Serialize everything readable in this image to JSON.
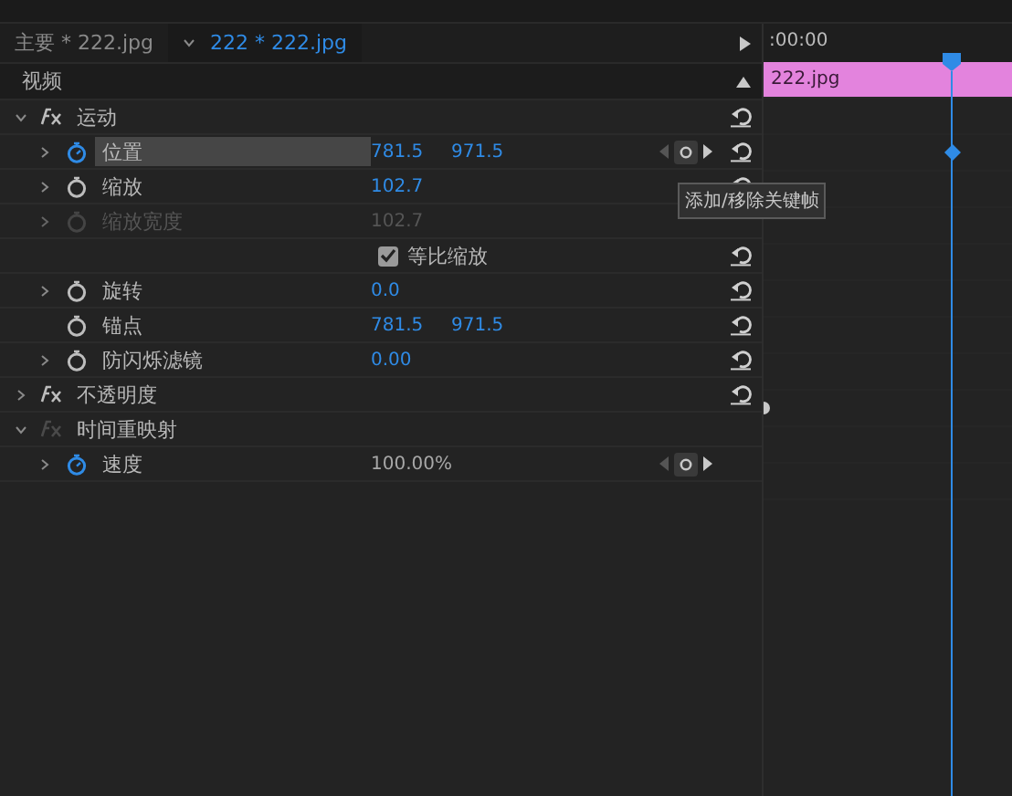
{
  "tabs": [
    {
      "label": "主要 * 222.jpg",
      "selected": false,
      "dropdown": false
    },
    {
      "label": "222 * 222.jpg",
      "selected": true,
      "dropdown": true
    }
  ],
  "section": {
    "label": "视频"
  },
  "timeline": {
    "time": ":00:00",
    "clip": "222.jpg"
  },
  "rows": [
    {
      "kind": "effect",
      "name": "运动",
      "expanded": true,
      "enabled": true,
      "reset": true
    },
    {
      "kind": "property",
      "name": "位置",
      "expandable": true,
      "animated": true,
      "disabled": false,
      "selected": true,
      "values": [
        "781.5",
        "971.5"
      ],
      "nav": true,
      "reset": true,
      "keyframe": true
    },
    {
      "kind": "property",
      "name": "缩放",
      "expandable": true,
      "animated": false,
      "disabled": false,
      "selected": false,
      "values": [
        "102.7"
      ],
      "nav": false,
      "reset": true
    },
    {
      "kind": "property",
      "name": "缩放宽度",
      "expandable": true,
      "animated": false,
      "disabled": true,
      "selected": false,
      "values": [
        "102.7"
      ],
      "nav": false,
      "reset": false
    },
    {
      "kind": "checkbox",
      "name": "等比缩放",
      "checked": true,
      "reset": true
    },
    {
      "kind": "property",
      "name": "旋转",
      "expandable": true,
      "animated": false,
      "disabled": false,
      "selected": false,
      "values": [
        "0.0"
      ],
      "nav": false,
      "reset": true
    },
    {
      "kind": "property",
      "name": "锚点",
      "expandable": false,
      "animated": false,
      "disabled": false,
      "selected": false,
      "values": [
        "781.5",
        "971.5"
      ],
      "nav": false,
      "reset": true
    },
    {
      "kind": "property",
      "name": "防闪烁滤镜",
      "expandable": true,
      "animated": false,
      "disabled": false,
      "selected": false,
      "values": [
        "0.00"
      ],
      "nav": false,
      "reset": true
    },
    {
      "kind": "effect",
      "name": "不透明度",
      "expanded": false,
      "enabled": true,
      "reset": true,
      "edge_marker": true
    },
    {
      "kind": "effect",
      "name": "时间重映射",
      "expanded": true,
      "enabled": false,
      "reset": false
    },
    {
      "kind": "property",
      "name": "速度",
      "expandable": true,
      "animated": true,
      "disabled": false,
      "muted": true,
      "selected": false,
      "values": [
        "100.00%"
      ],
      "nav": true,
      "reset": false
    }
  ],
  "tooltip": {
    "text": "添加/移除关键帧"
  }
}
